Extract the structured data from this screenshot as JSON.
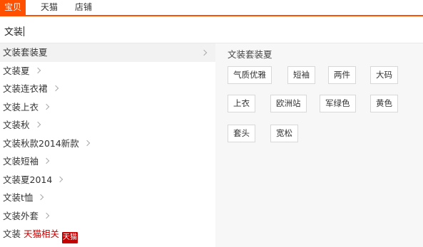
{
  "tabs": [
    "宝贝",
    "天猫",
    "店铺"
  ],
  "search": {
    "value": "文装"
  },
  "suggestions": [
    {
      "text": "文装套装夏"
    },
    {
      "text": "文装夏"
    },
    {
      "text": "文装连衣裙"
    },
    {
      "text": "文装上衣"
    },
    {
      "text": "文装秋"
    },
    {
      "text": "文装秋款2014新款"
    },
    {
      "text": "文装短袖"
    },
    {
      "text": "文装夏2014"
    },
    {
      "text": "文装t恤"
    },
    {
      "text": "文装外套"
    }
  ],
  "tmall_row": {
    "prefix": "文装",
    "label": "天猫相关",
    "badge": "天猫"
  },
  "panel": {
    "title": "文装套装夏",
    "tags": [
      "气质优雅",
      "短袖",
      "两件",
      "大码",
      "上衣",
      "欧洲站",
      "军绿色",
      "黄色",
      "套头",
      "宽松"
    ]
  },
  "colors": {
    "accent": "#ff5000",
    "tmall": "#c40000"
  }
}
